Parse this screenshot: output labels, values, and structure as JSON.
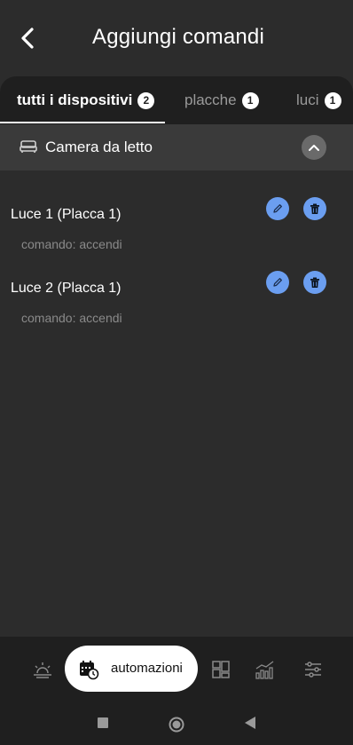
{
  "header": {
    "title": "Aggiungi comandi"
  },
  "tabs": [
    {
      "label": "tutti i dispositivi",
      "count": "2",
      "active": true
    },
    {
      "label": "placche",
      "count": "1",
      "active": false
    },
    {
      "label": "luci",
      "count": "1",
      "active": false
    }
  ],
  "room": {
    "name": "Camera da letto",
    "icon": "bed-icon",
    "expanded": true
  },
  "commands": [
    {
      "name": "Luce 1 (Placca 1)",
      "subtitle": "comando: accendi"
    },
    {
      "name": "Luce 2 (Placca 1)",
      "subtitle": "comando: accendi"
    }
  ],
  "bottom_nav": {
    "active_label": "automazioni",
    "items": [
      "sunrise-icon",
      "calendar-clock-icon",
      "dashboard-grid-icon",
      "chart-icon",
      "sliders-icon"
    ]
  },
  "colors": {
    "background": "#2c2c2c",
    "tab_bar": "#1f1f1f",
    "room_bar": "#3a3a3a",
    "action_button": "#6b9ef0",
    "muted_text": "#8a8a8a"
  }
}
